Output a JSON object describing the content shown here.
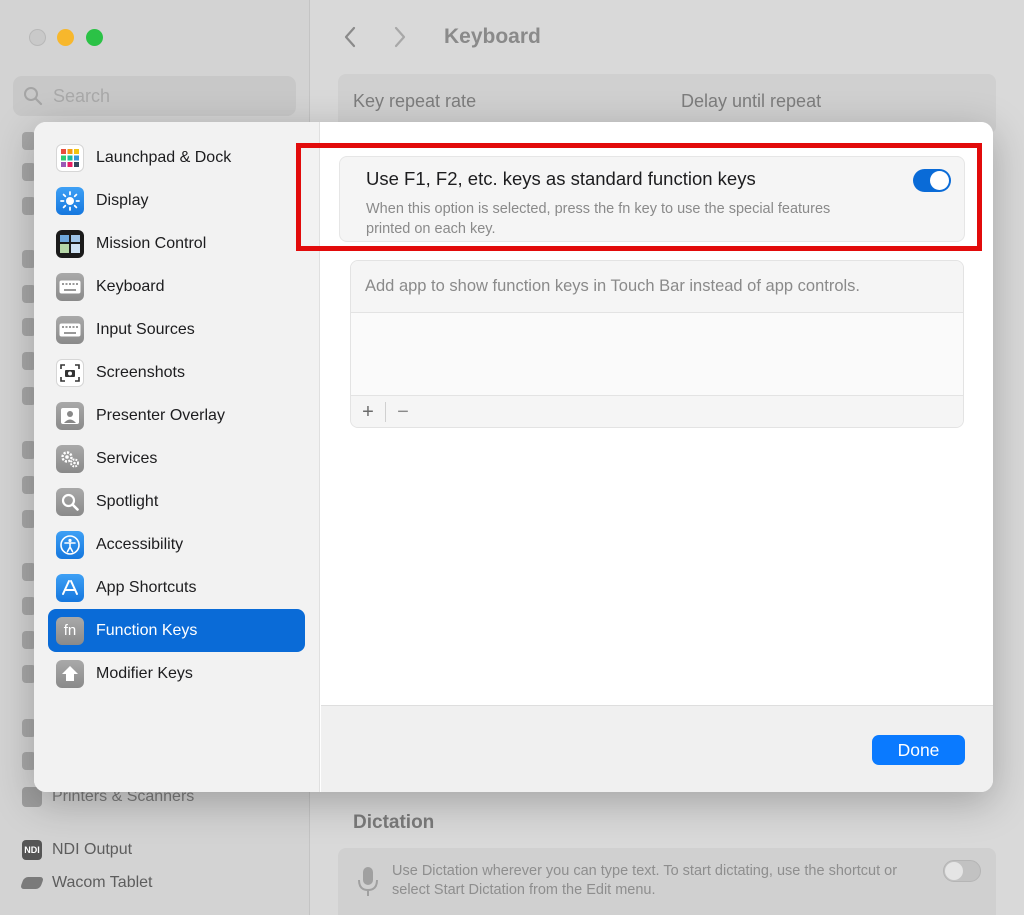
{
  "background": {
    "search_placeholder": "Search",
    "title": "Keyboard",
    "key_repeat_label": "Key repeat rate",
    "delay_label": "Delay until repeat",
    "sidebar_items": [
      {
        "label": "Printers & Scanners",
        "icon": "printer-icon"
      },
      {
        "label": "NDI Output",
        "icon": "ndi-icon"
      },
      {
        "label": "Wacom Tablet",
        "icon": "tablet-icon"
      }
    ],
    "dictation_title": "Dictation",
    "dictation_text": "Use Dictation wherever you can type text. To start dictating, use the shortcut or select Start Dictation from the Edit menu."
  },
  "sheet": {
    "sidebar": [
      {
        "label": "Launchpad & Dock",
        "icon": "launchpad-icon"
      },
      {
        "label": "Display",
        "icon": "display-icon"
      },
      {
        "label": "Mission Control",
        "icon": "mission-control-icon"
      },
      {
        "label": "Keyboard",
        "icon": "keyboard-icon"
      },
      {
        "label": "Input Sources",
        "icon": "input-sources-icon"
      },
      {
        "label": "Screenshots",
        "icon": "screenshot-icon"
      },
      {
        "label": "Presenter Overlay",
        "icon": "presenter-icon"
      },
      {
        "label": "Services",
        "icon": "services-icon"
      },
      {
        "label": "Spotlight",
        "icon": "spotlight-icon"
      },
      {
        "label": "Accessibility",
        "icon": "accessibility-icon"
      },
      {
        "label": "App Shortcuts",
        "icon": "app-store-icon"
      },
      {
        "label": "Function Keys",
        "icon": "fn-icon",
        "selected": true
      },
      {
        "label": "Modifier Keys",
        "icon": "modifier-icon"
      }
    ],
    "function_keys": {
      "title": "Use F1, F2, etc. keys as standard function keys",
      "description": "When this option is selected, press the fn key to use the special features printed on each key.",
      "enabled": true
    },
    "apps": {
      "header": "Add app to show function keys in Touch Bar instead of app controls.",
      "add_label": "+",
      "remove_label": "−"
    },
    "done_label": "Done"
  },
  "colors": {
    "accent": "#0a6bd7",
    "highlight": "#e20b0b"
  }
}
